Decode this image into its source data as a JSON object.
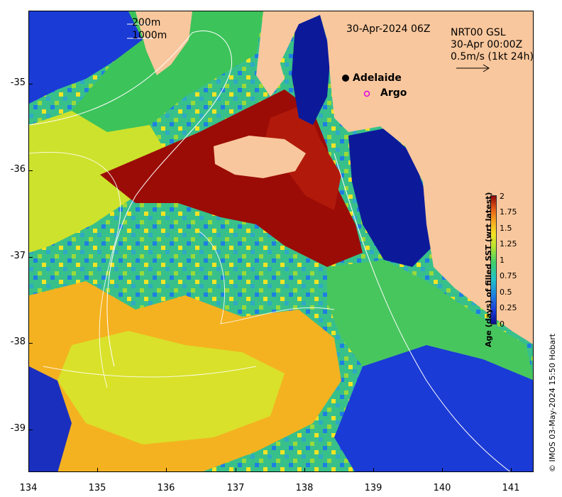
{
  "title": "30-Apr-2024 06Z",
  "legend": {
    "contour_200": "200m",
    "contour_1000": "1000m",
    "currents_source": "NRT00 GSL",
    "currents_time": "30-Apr 00:00Z",
    "vector_scale": "0.5m/s (1kt 24h)"
  },
  "places": [
    {
      "name": "Adelaide",
      "marker": "filled-circle",
      "color": "#000000"
    },
    {
      "name": "Argo",
      "marker": "open-circle",
      "color": "#e000e0"
    }
  ],
  "axes": {
    "x_ticks": [
      "134",
      "135",
      "136",
      "137",
      "138",
      "139",
      "140",
      "141"
    ],
    "y_ticks": [
      "-35",
      "-36",
      "-37",
      "-38",
      "-39"
    ]
  },
  "colorbar": {
    "title": "Age (days) of filled SST (wrt latest)",
    "ticks": [
      "2",
      "1.75",
      "1.5",
      "1.25",
      "1",
      "0.75",
      "0.5",
      "0.25",
      "0"
    ],
    "range": [
      0,
      2
    ]
  },
  "credit": "© IMOS 03-May-2024 15:50 Hobart",
  "colors": {
    "land": "#f9c79d",
    "coastline": "#000000",
    "contour": "#ffffff"
  }
}
